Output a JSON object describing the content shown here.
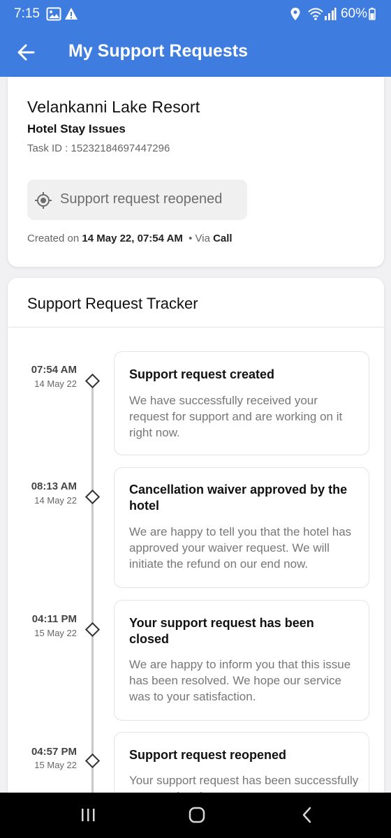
{
  "status_bar": {
    "time": "7:15",
    "battery": "60%",
    "icons": [
      "gallery-notification-icon",
      "warning-icon",
      "location-icon",
      "wifi-icon",
      "signal-icon",
      "battery-icon"
    ]
  },
  "app_bar": {
    "title": "My Support Requests",
    "back_icon": "arrow-left-icon"
  },
  "request": {
    "hotel_name": "Velankanni Lake Resort",
    "issue_type": "Hotel Stay Issues",
    "task_id": "Task ID : 15232184697447296",
    "status": "Support request reopened",
    "status_icon": "target-icon",
    "created_prefix": "Created on",
    "created_date": "14 May 22, 07:54 AM",
    "via_prefix": "• Via",
    "via_channel": "Call"
  },
  "tracker": {
    "title": "Support Request Tracker",
    "events": [
      {
        "time": "07:54 AM",
        "date": "14 May 22",
        "title": "Support request created",
        "description": "We have successfully received your request for support and are working on it right now."
      },
      {
        "time": "08:13 AM",
        "date": "14 May 22",
        "title": "Cancellation waiver approved by the hotel",
        "description": "We are happy to tell you that the hotel has approved your waiver request. We will initiate the refund on our end now."
      },
      {
        "time": "04:11 PM",
        "date": "15 May 22",
        "title": "Your support request has been closed",
        "description": "We are happy to inform you that this issue has been resolved. We hope our service was to your satisfaction."
      },
      {
        "time": "04:57 PM",
        "date": "15 May 22",
        "title": "Support request reopened",
        "description": "Your support request has been successfully reopened and ..."
      }
    ]
  },
  "nav_bar": {
    "icons": [
      "recent-apps-icon",
      "home-icon",
      "back-icon"
    ]
  },
  "colors": {
    "primary": "#3e7ce0",
    "background": "#f1f1f3",
    "card": "#ffffff",
    "chip": "#f0f0f0"
  }
}
